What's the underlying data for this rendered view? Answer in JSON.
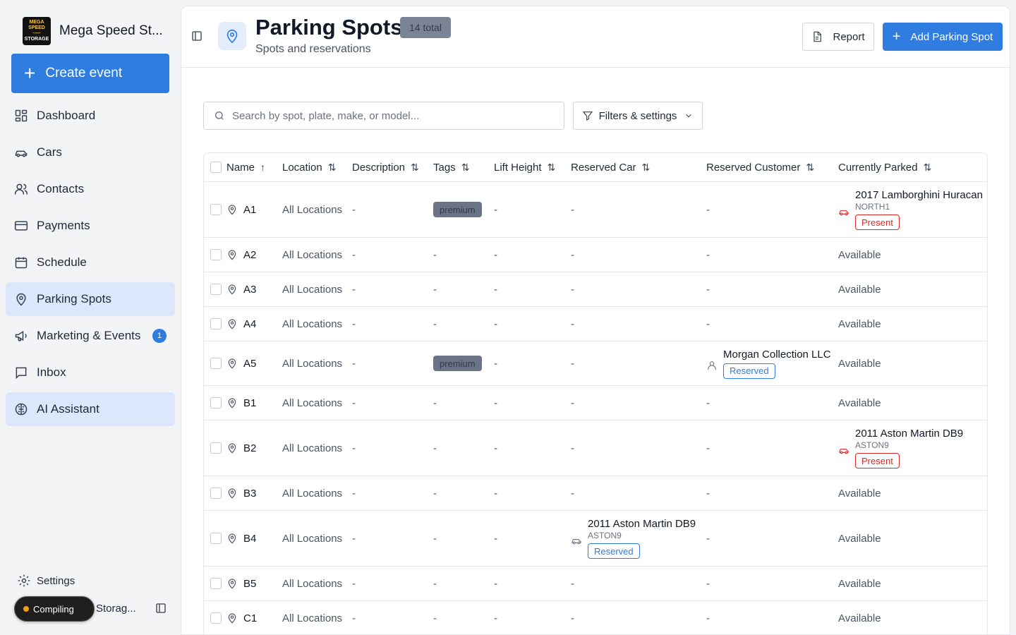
{
  "brand": {
    "name": "Mega Speed St...",
    "logo_lines": [
      "MEGA SPEED",
      "·—·",
      "STORAGE"
    ]
  },
  "sidebar": {
    "create_label": "Create event",
    "items": [
      {
        "label": "Dashboard",
        "icon": "dashboard-icon",
        "active": false
      },
      {
        "label": "Cars",
        "icon": "car-icon",
        "active": false
      },
      {
        "label": "Contacts",
        "icon": "contacts-icon",
        "active": false
      },
      {
        "label": "Payments",
        "icon": "credit-card-icon",
        "active": false
      },
      {
        "label": "Schedule",
        "icon": "calendar-icon",
        "active": false
      },
      {
        "label": "Parking Spots",
        "icon": "map-pin-icon",
        "active": true
      },
      {
        "label": "Marketing & Events",
        "icon": "megaphone-icon",
        "active": false,
        "badge": "1"
      },
      {
        "label": "Inbox",
        "icon": "inbox-icon",
        "active": false
      },
      {
        "label": "AI Assistant",
        "icon": "brain-icon",
        "active": true
      }
    ],
    "settings_label": "Settings",
    "compiling_label": "Compiling",
    "user_label": "Storag..."
  },
  "header": {
    "title": "Parking Spots",
    "total_badge": "14 total",
    "subtitle": "Spots and reservations",
    "report_label": "Report",
    "add_label": "Add Parking Spot"
  },
  "search": {
    "placeholder": "Search by spot, plate, make, or model...",
    "value": ""
  },
  "filters_label": "Filters & settings",
  "table": {
    "columns": [
      {
        "label": "Name",
        "sort": "↑"
      },
      {
        "label": "Location",
        "sort": "⇅"
      },
      {
        "label": "Description",
        "sort": "⇅"
      },
      {
        "label": "Tags",
        "sort": "⇅"
      },
      {
        "label": "Lift Height",
        "sort": "⇅"
      },
      {
        "label": "Reserved Car",
        "sort": "⇅"
      },
      {
        "label": "Reserved Customer",
        "sort": "⇅"
      },
      {
        "label": "Currently Parked",
        "sort": "⇅"
      }
    ],
    "rows": [
      {
        "name": "A1",
        "location": "All Locations",
        "description": "-",
        "tag": "premium",
        "lift_height": "-",
        "reserved_car": "-",
        "reserved_customer": "-",
        "parked": {
          "title": "2017 Lamborghini Huracan",
          "plate": "NORTH1",
          "status": "Present"
        }
      },
      {
        "name": "A2",
        "location": "All Locations",
        "description": "-",
        "tag": "-",
        "lift_height": "-",
        "reserved_car": "-",
        "reserved_customer": "-",
        "parked_text": "Available"
      },
      {
        "name": "A3",
        "location": "All Locations",
        "description": "-",
        "tag": "-",
        "lift_height": "-",
        "reserved_car": "-",
        "reserved_customer": "-",
        "parked_text": "Available"
      },
      {
        "name": "A4",
        "location": "All Locations",
        "description": "-",
        "tag": "-",
        "lift_height": "-",
        "reserved_car": "-",
        "reserved_customer": "-",
        "parked_text": "Available"
      },
      {
        "name": "A5",
        "location": "All Locations",
        "description": "-",
        "tag": "premium",
        "lift_height": "-",
        "reserved_car": "-",
        "customer": {
          "name": "Morgan Collection LLC",
          "status": "Reserved"
        },
        "parked_text": "Available"
      },
      {
        "name": "B1",
        "location": "All Locations",
        "description": "-",
        "tag": "-",
        "lift_height": "-",
        "reserved_car": "-",
        "reserved_customer": "-",
        "parked_text": "Available"
      },
      {
        "name": "B2",
        "location": "All Locations",
        "description": "-",
        "tag": "-",
        "lift_height": "-",
        "reserved_car": "-",
        "reserved_customer": "-",
        "parked": {
          "title": "2011 Aston Martin DB9",
          "plate": "ASTON9",
          "status": "Present"
        }
      },
      {
        "name": "B3",
        "location": "All Locations",
        "description": "-",
        "tag": "-",
        "lift_height": "-",
        "reserved_car": "-",
        "reserved_customer": "-",
        "parked_text": "Available"
      },
      {
        "name": "B4",
        "location": "All Locations",
        "description": "-",
        "tag": "-",
        "lift_height": "-",
        "car": {
          "title": "2011 Aston Martin DB9",
          "plate": "ASTON9",
          "status": "Reserved"
        },
        "reserved_customer": "-",
        "parked_text": "Available"
      },
      {
        "name": "B5",
        "location": "All Locations",
        "description": "-",
        "tag": "-",
        "lift_height": "-",
        "reserved_car": "-",
        "reserved_customer": "-",
        "parked_text": "Available"
      },
      {
        "name": "C1",
        "location": "All Locations",
        "description": "-",
        "tag": "-",
        "lift_height": "-",
        "reserved_car": "-",
        "reserved_customer": "-",
        "parked_text": "Available"
      }
    ]
  },
  "colors": {
    "accent": "#2f7de1",
    "present": "#dc2626",
    "active_nav": "#dde7fb"
  }
}
